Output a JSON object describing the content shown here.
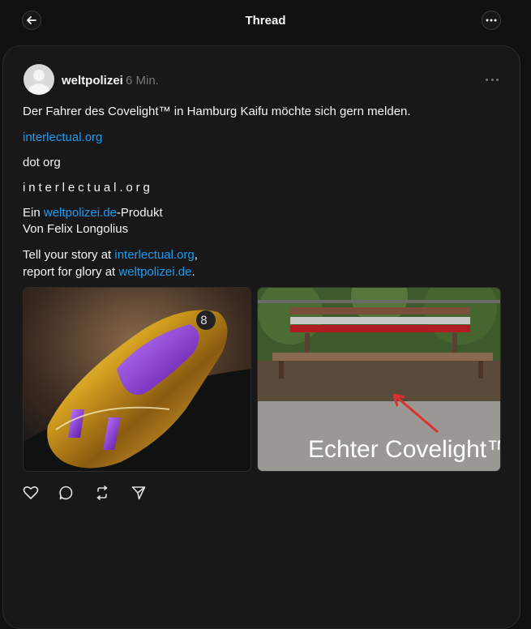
{
  "header": {
    "title": "Thread",
    "back_icon": "arrow-left-icon",
    "more_icon": "ellipsis-icon"
  },
  "post": {
    "author": "weltpolizei",
    "time": "6 Min.",
    "more_icon": "ellipsis-icon",
    "lines": {
      "l1": "Der Fahrer des Covelight™ in Hamburg Kaifu möchte sich gern melden.",
      "l2_link": "interlectual.org",
      "l3": "dot org",
      "l4": "interlectual.org",
      "l5_pre": "Ein ",
      "l5_link": "weltpolizei.de",
      "l5_post": "-Produkt",
      "l6": "Von Felix Longolius",
      "l7_pre": "Tell your story at ",
      "l7_link": "interlectual.org",
      "l7_post": ",",
      "l8_pre": "report for glory at ",
      "l8_link": "weltpolizei.de",
      "l8_post": "."
    },
    "images": {
      "image1_description": "gold toy car",
      "image2_caption": "Echter Covelight™"
    },
    "actions": {
      "like_icon": "heart-icon",
      "reply_icon": "comment-icon",
      "repost_icon": "repost-icon",
      "share_icon": "send-icon"
    }
  },
  "colors": {
    "background": "#101010",
    "card": "#181818",
    "link": "#1d9bf0",
    "muted": "#777777"
  }
}
